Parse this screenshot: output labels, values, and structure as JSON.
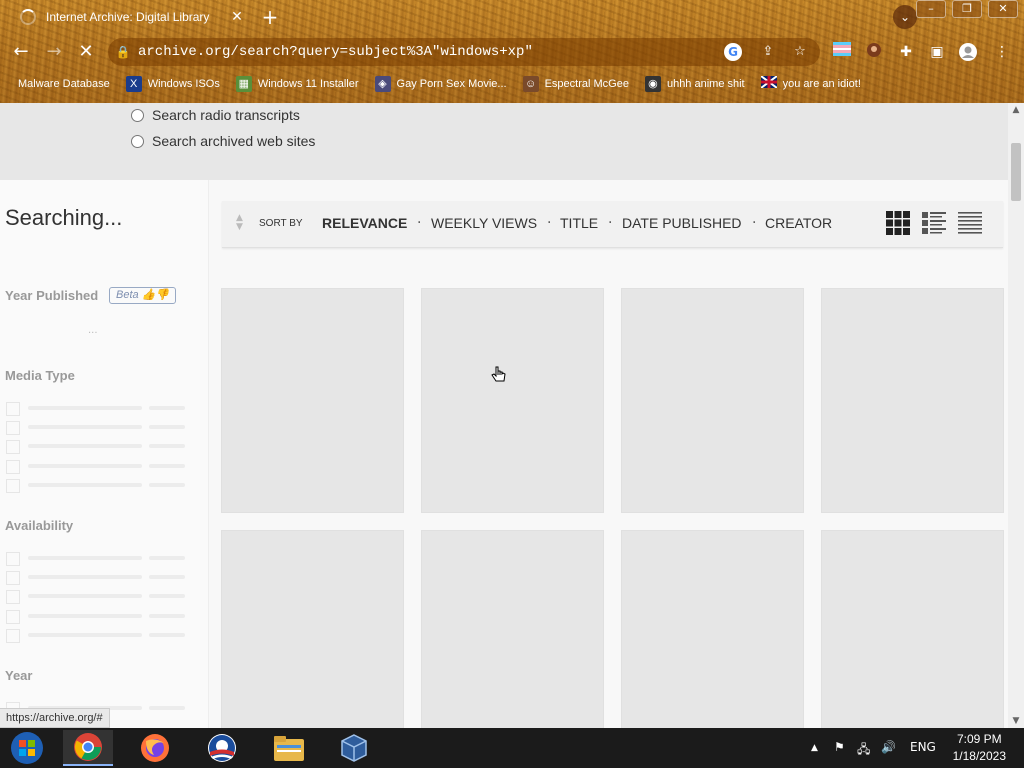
{
  "browser": {
    "tab_title": "Internet Archive: Digital Library",
    "url": "archive.org/search?query=subject%3A\"windows+xp\"",
    "bookmarks": [
      {
        "label": "Malware Database",
        "icon": "malware-icon",
        "color": "#2b7a2b"
      },
      {
        "label": "Windows ISOs",
        "icon": "x-icon",
        "color": "#1a3c8c"
      },
      {
        "label": "Windows 11 Installer",
        "icon": "image-icon",
        "color": "#5a8f3a"
      },
      {
        "label": "Gay Porn Sex Movie...",
        "icon": "app-icon",
        "color": "#4a4a7a"
      },
      {
        "label": "Espectral McGee",
        "icon": "face-icon",
        "color": "#7a4a2a"
      },
      {
        "label": "uhhh anime shit",
        "icon": "anime-icon",
        "color": "#333333"
      },
      {
        "label": "you are an idiot!",
        "icon": "flag-icon",
        "color": "#b22234"
      }
    ],
    "status_url": "https://archive.org/#"
  },
  "search_options": [
    "Search radio transcripts",
    "Search archived web sites"
  ],
  "sidebar": {
    "status": "Searching...",
    "facets": {
      "year_published": "Year Published",
      "beta_label": "Beta",
      "media_type": "Media Type",
      "availability": "Availability",
      "year": "Year"
    },
    "placeholder_dots": "..."
  },
  "sort": {
    "label": "SORT BY",
    "options": [
      "RELEVANCE",
      "WEEKLY VIEWS",
      "TITLE",
      "DATE PUBLISHED",
      "CREATOR"
    ],
    "active": "RELEVANCE"
  },
  "taskbar": {
    "time": "7:09 PM",
    "date": "1/18/2023",
    "lang": "ENG"
  }
}
